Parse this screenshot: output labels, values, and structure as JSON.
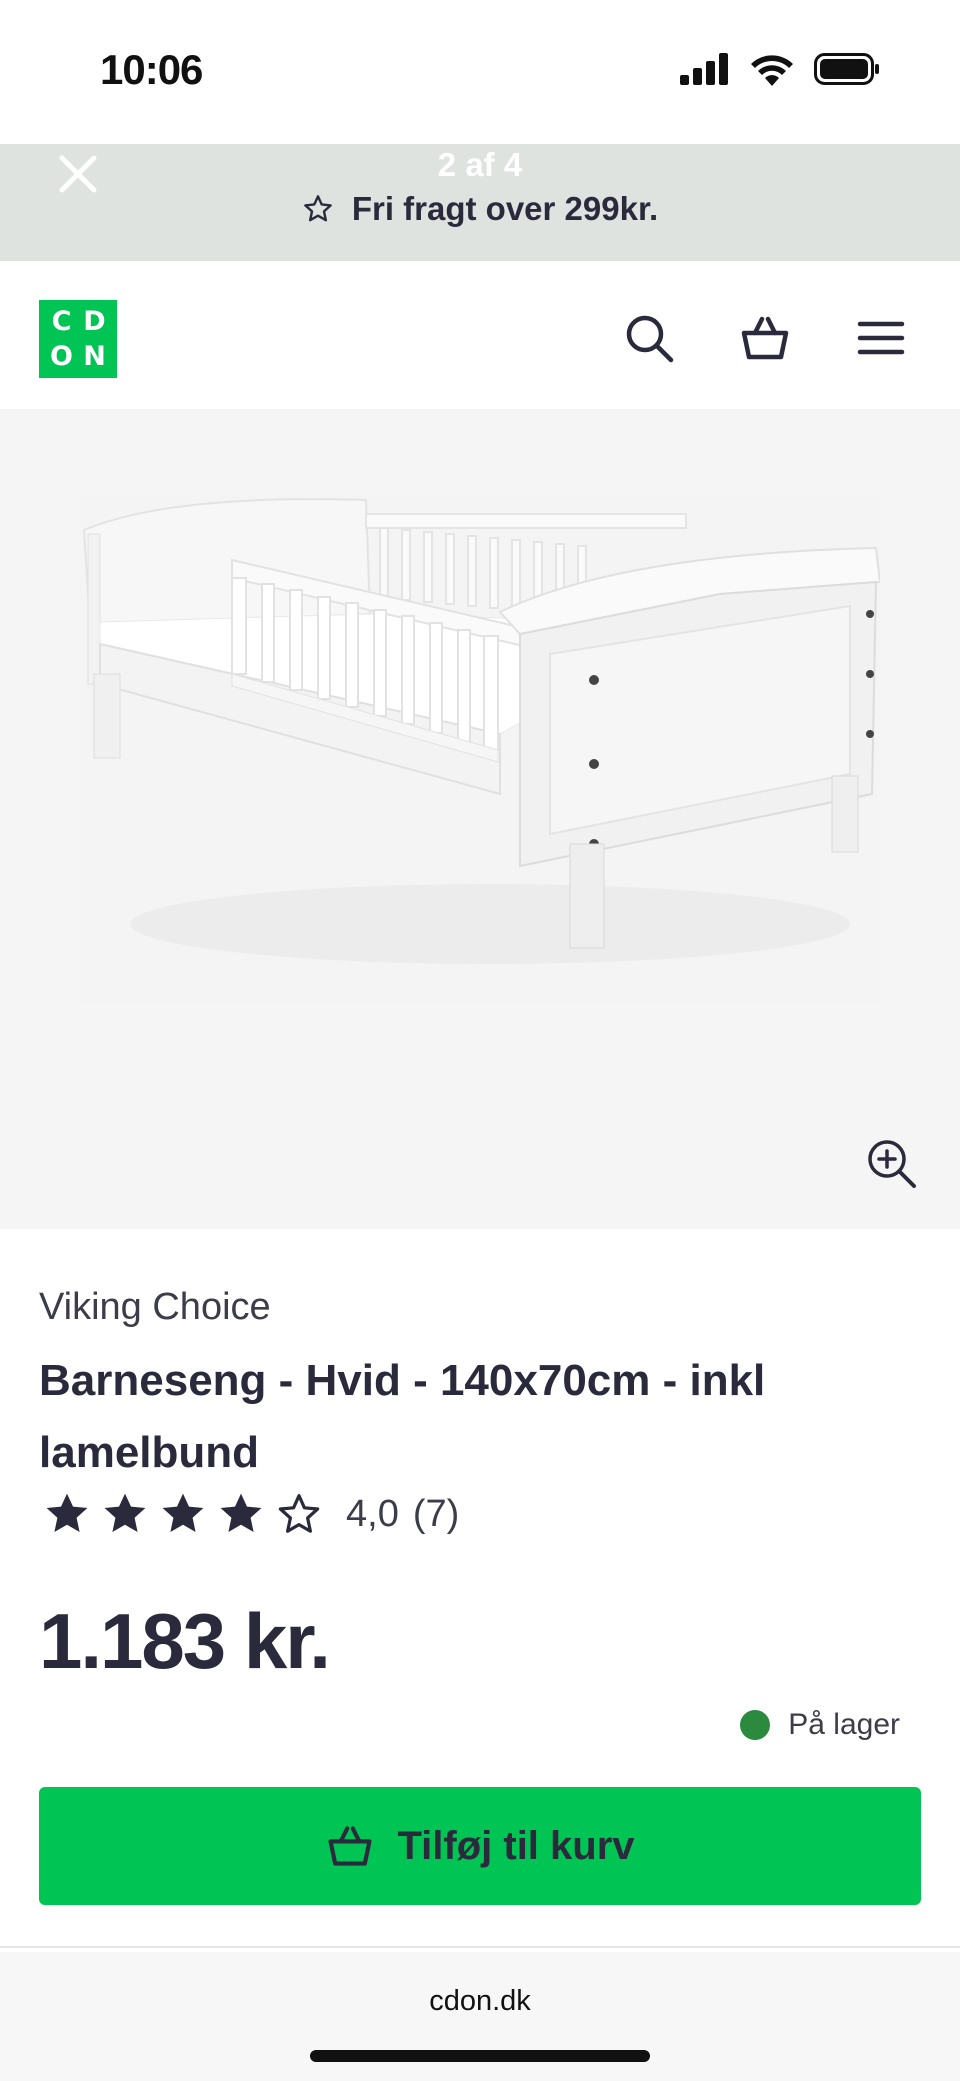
{
  "status_bar": {
    "time": "10:06"
  },
  "promo": {
    "counter": "2 af 4",
    "text": "Fri fragt over 299kr."
  },
  "header": {
    "logo": {
      "top_left": "C",
      "top_right": "D",
      "bottom_left": "O",
      "bottom_right": "N",
      "color": "#00c454"
    },
    "icons": [
      "search-icon",
      "basket-icon",
      "menu-icon"
    ]
  },
  "product": {
    "brand": "Viking Choice",
    "title": "Barneseng - Hvid - 140x70cm - inkl lamelbund",
    "rating_value": 4,
    "rating_max": 5,
    "rating_text": "4,0",
    "review_count": "(7)",
    "price": "1.183 kr.",
    "stock_status": "På lager",
    "stock_color": "#2b8a3e",
    "add_to_cart_label": "Tilføj til kurv",
    "accent_color": "#00c454"
  },
  "browser": {
    "url": "cdon.dk"
  }
}
